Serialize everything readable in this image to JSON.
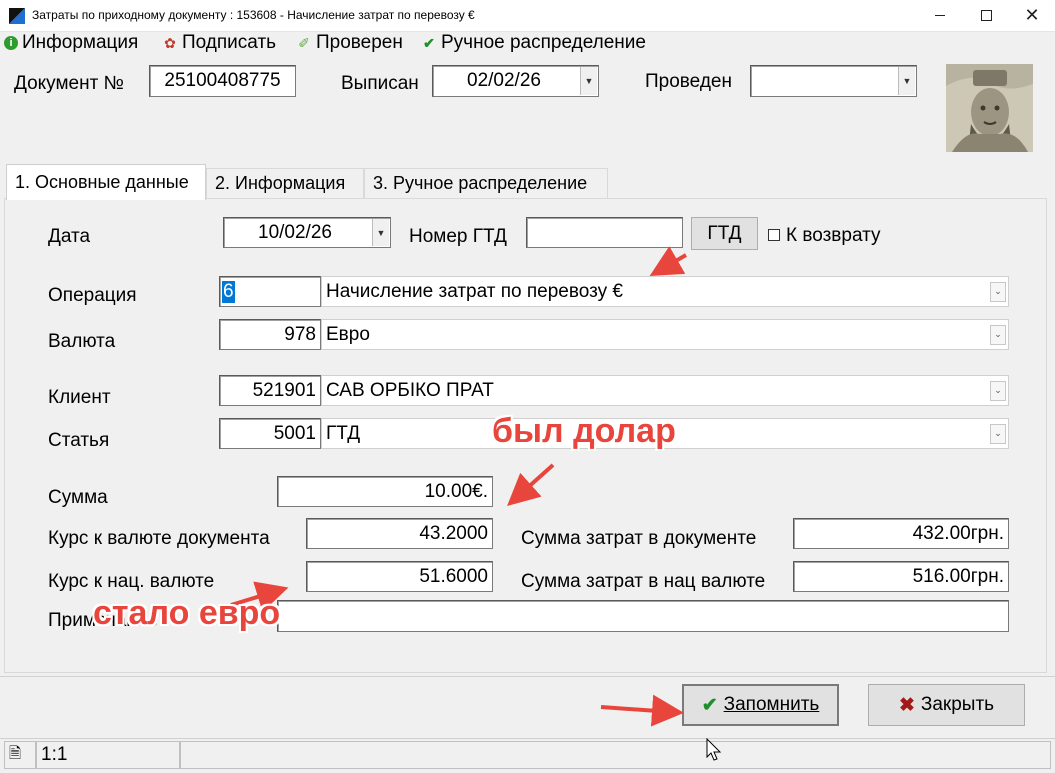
{
  "window": {
    "title": "Затраты по приходному документу : 153608 - Начисление затрат по перевозу  €",
    "minimize_icon": "minimize-icon",
    "maximize_icon": "maximize-icon",
    "close_icon": "close-icon"
  },
  "menu": [
    {
      "label": "Информация",
      "icon": "info-icon",
      "color": "#2e9b2e"
    },
    {
      "label": "Подписать",
      "icon": "seal-icon",
      "color": "#c0392b"
    },
    {
      "label": "Проверен",
      "icon": "check-tag-icon",
      "color": "#6aa84f"
    },
    {
      "label": "Ручное распределение",
      "icon": "check-icon",
      "color": "#1e8f2a"
    }
  ],
  "header": {
    "doc_label": "Документ №",
    "doc_value": "25100408775",
    "issued_label": "Выписан",
    "issued_value": "02/02/26",
    "posted_label": "Проведен",
    "posted_value": ""
  },
  "tabs": [
    {
      "label": "1. Основные данные",
      "active": true
    },
    {
      "label": "2. Информация",
      "active": false
    },
    {
      "label": "3. Ручное распределение",
      "active": false
    }
  ],
  "form": {
    "date_label": "Дата",
    "date_value": "10/02/26",
    "gtd_number_label": "Номер ГТД",
    "gtd_number_value": "",
    "gtd_button": "ГТД",
    "return_label": "К возврату",
    "return_checked": false,
    "operation_label": "Операция",
    "operation_code": "6",
    "operation_name": "Начисление затрат по перевозу  €",
    "currency_label": "Валюта",
    "currency_code": "978",
    "currency_name": "Евро",
    "client_label": "Клиент",
    "client_code": "521901",
    "client_name": "САВ ОРБІКО ПРАТ",
    "article_label": "Статья",
    "article_code": "5001",
    "article_name": "ГТД",
    "sum_label": "Сумма",
    "sum_value": "10.00€.",
    "rate_doc_label": "Курс к валюте документа",
    "rate_doc_value": "43.2000",
    "rate_nat_label": "Курс к нац. валюте",
    "rate_nat_value": "51.6000",
    "cost_doc_label": "Сумма затрат в документе",
    "cost_doc_value": "432.00грн.",
    "cost_nat_label": "Сумма затрат в нац валюте",
    "cost_nat_value": "516.00грн.",
    "note_label": "Примечание",
    "note_value": ""
  },
  "buttons": {
    "save_label": "Запомнить",
    "save_icon": "checkmark-icon",
    "close_label": "Закрыть",
    "close_icon": "x-icon"
  },
  "annotations": {
    "was_text": "был долар",
    "became_text": "стало евро",
    "color": "#e8463c"
  },
  "statusbar": {
    "position": "1:1",
    "icon": "document-icon"
  },
  "colors": {
    "window_bg": "#f0f0f0",
    "field_bg": "#ffffff",
    "selection": "#0078d7"
  }
}
